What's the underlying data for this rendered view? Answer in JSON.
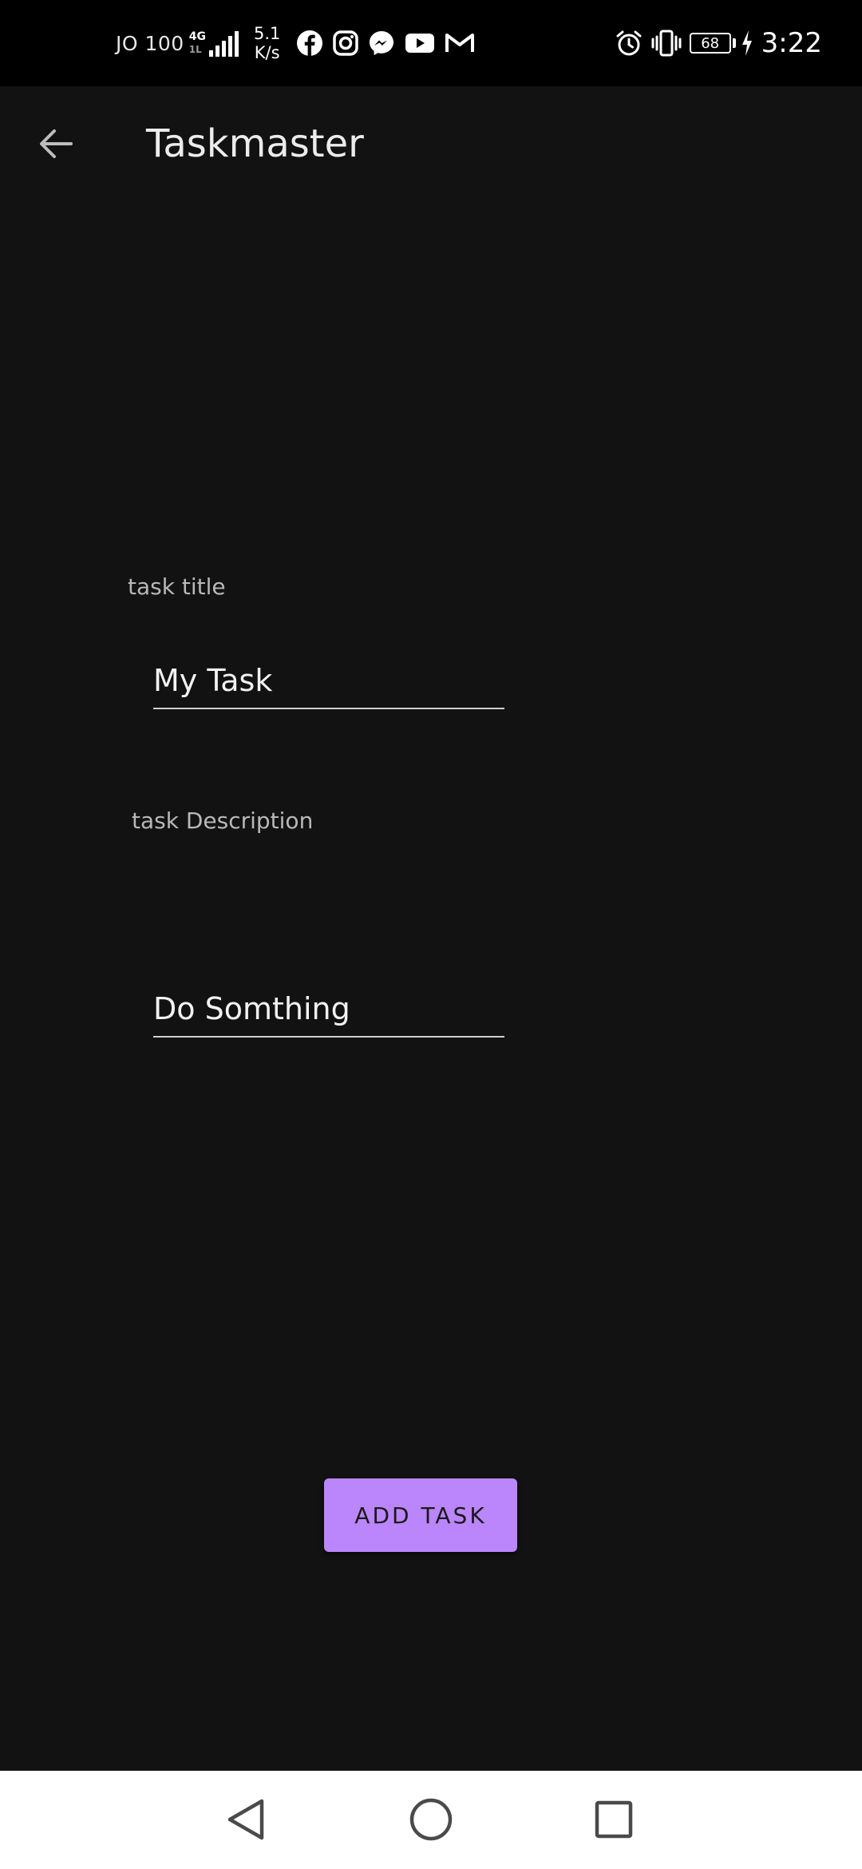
{
  "status_bar": {
    "carrier": "JO 100",
    "network_type": "4G",
    "network_sub": "1L",
    "speed_value": "5.1",
    "speed_unit": "K/s",
    "notification_icons": [
      "facebook-icon",
      "instagram-icon",
      "messenger-icon",
      "youtube-icon",
      "gmail-icon"
    ],
    "right_icons": [
      "alarm-icon",
      "vibrate-icon",
      "battery-icon",
      "charging-icon"
    ],
    "battery_level": "68",
    "time": "3:22"
  },
  "app_bar": {
    "back_icon": "arrow-left-icon",
    "title": "Taskmaster"
  },
  "form": {
    "title_label": "task title",
    "title_value": "My Task",
    "description_label": "task Description",
    "description_value": "Do Somthing",
    "submit_label": "ADD TASK"
  },
  "nav_bar": {
    "icons": [
      "nav-back-icon",
      "nav-home-icon",
      "nav-recents-icon"
    ]
  },
  "colors": {
    "background": "#121212",
    "status_bar": "#000000",
    "accent": "#bb86fc",
    "nav_bar": "#ffffff"
  }
}
